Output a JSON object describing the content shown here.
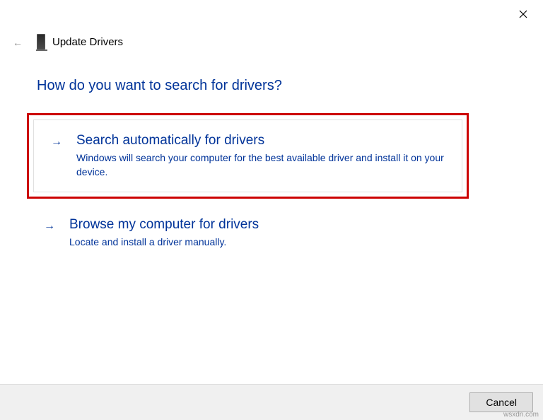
{
  "header": {
    "title": "Update Drivers"
  },
  "main": {
    "heading": "How do you want to search for drivers?"
  },
  "options": {
    "auto": {
      "title": "Search automatically for drivers",
      "desc": "Windows will search your computer for the best available driver and install it on your device."
    },
    "browse": {
      "title": "Browse my computer for drivers",
      "desc": "Locate and install a driver manually."
    }
  },
  "footer": {
    "cancel": "Cancel"
  },
  "watermark": "wsxdn.com"
}
